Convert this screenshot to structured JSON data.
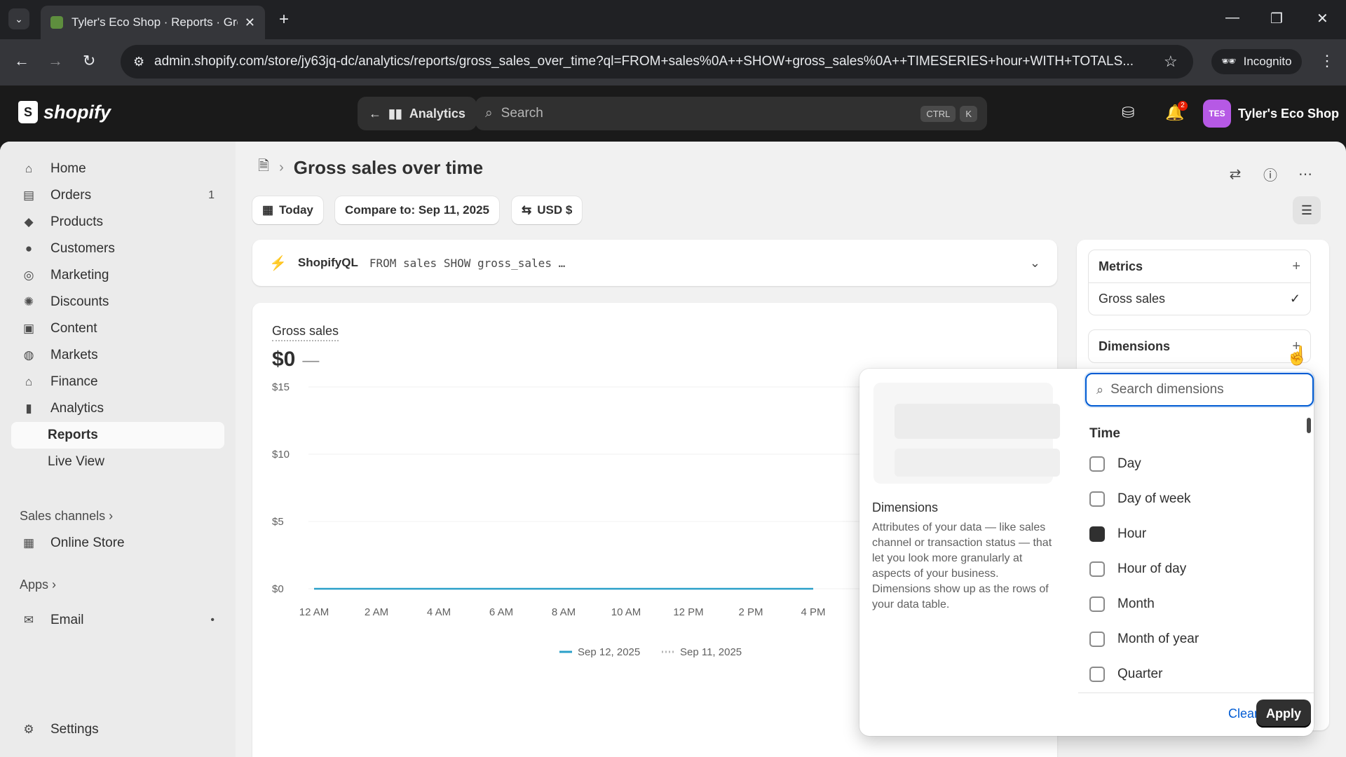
{
  "browser": {
    "tab_title": "Tyler's Eco Shop · Reports · Gro",
    "url": "admin.shopify.com/store/jy63jq-dc/analytics/reports/gross_sales_over_time?ql=FROM+sales%0A++SHOW+gross_sales%0A++TIMESERIES+hour+WITH+TOTALS...",
    "incognito_label": "Incognito"
  },
  "topbar": {
    "logo_text": "shopify",
    "analytics_label": "Analytics",
    "search_placeholder": "Search",
    "kbd1": "CTRL",
    "kbd2": "K",
    "notif_count": "2",
    "store_initials": "TES",
    "store_name": "Tyler's Eco Shop"
  },
  "sidebar": {
    "items": [
      {
        "label": "Home",
        "icon": "home-icon"
      },
      {
        "label": "Orders",
        "icon": "orders-icon",
        "badge": "1"
      },
      {
        "label": "Products",
        "icon": "tag-icon"
      },
      {
        "label": "Customers",
        "icon": "person-icon"
      },
      {
        "label": "Marketing",
        "icon": "target-icon"
      },
      {
        "label": "Discounts",
        "icon": "discount-icon"
      },
      {
        "label": "Content",
        "icon": "content-icon"
      },
      {
        "label": "Markets",
        "icon": "globe-icon"
      },
      {
        "label": "Finance",
        "icon": "bank-icon"
      },
      {
        "label": "Analytics",
        "icon": "bar-chart-icon"
      },
      {
        "label": "Reports"
      },
      {
        "label": "Live View"
      }
    ],
    "sales_channels": "Sales channels",
    "online_store": "Online Store",
    "apps": "Apps",
    "email": "Email",
    "email_dot": "•",
    "settings": "Settings"
  },
  "header": {
    "title": "Gross sales over time",
    "date_label": "Today",
    "compare_label": "Compare to: Sep 11, 2025",
    "currency_label": "USD $"
  },
  "query": {
    "label": "ShopifyQL",
    "text": "FROM sales SHOW gross_sales …"
  },
  "chart_data": {
    "type": "line",
    "title": "Gross sales",
    "headline_value": "$0",
    "headline_change": "—",
    "categories": [
      "12 AM",
      "2 AM",
      "4 AM",
      "6 AM",
      "8 AM",
      "10 AM",
      "12 PM",
      "2 PM",
      "4 PM"
    ],
    "y_ticks": [
      "$15",
      "$10",
      "$5",
      "$0"
    ],
    "ylim": [
      0,
      15
    ],
    "series": [
      {
        "name": "Sep 12, 2025",
        "values": [
          0,
          0,
          0,
          0,
          0,
          0,
          0,
          0,
          0
        ],
        "color": "#2ba0c9",
        "style": "solid"
      },
      {
        "name": "Sep 11, 2025",
        "style": "dotted",
        "color": "#b5b5b5"
      }
    ],
    "grid": true,
    "legend": "bottom-center"
  },
  "panel": {
    "metrics_title": "Metrics",
    "metric_item": "Gross sales",
    "dimensions_title": "Dimensions"
  },
  "popover": {
    "search_placeholder": "Search dimensions",
    "preview_title": "Dimensions",
    "preview_desc": "Attributes of your data — like sales channel or transaction status — that let you look more granularly at aspects of your business. Dimensions show up as the rows of your data table.",
    "group": "Time",
    "options": [
      {
        "label": "Day",
        "checked": false
      },
      {
        "label": "Day of week",
        "checked": false
      },
      {
        "label": "Hour",
        "checked": true
      },
      {
        "label": "Hour of day",
        "checked": false
      },
      {
        "label": "Month",
        "checked": false
      },
      {
        "label": "Month of year",
        "checked": false
      },
      {
        "label": "Quarter",
        "checked": false
      }
    ],
    "clear_label": "Clear",
    "apply_label": "Apply"
  },
  "colors": {
    "accent_blue": "#005bd3",
    "series_line": "#2ba0c9",
    "dark_button": "#303030"
  }
}
